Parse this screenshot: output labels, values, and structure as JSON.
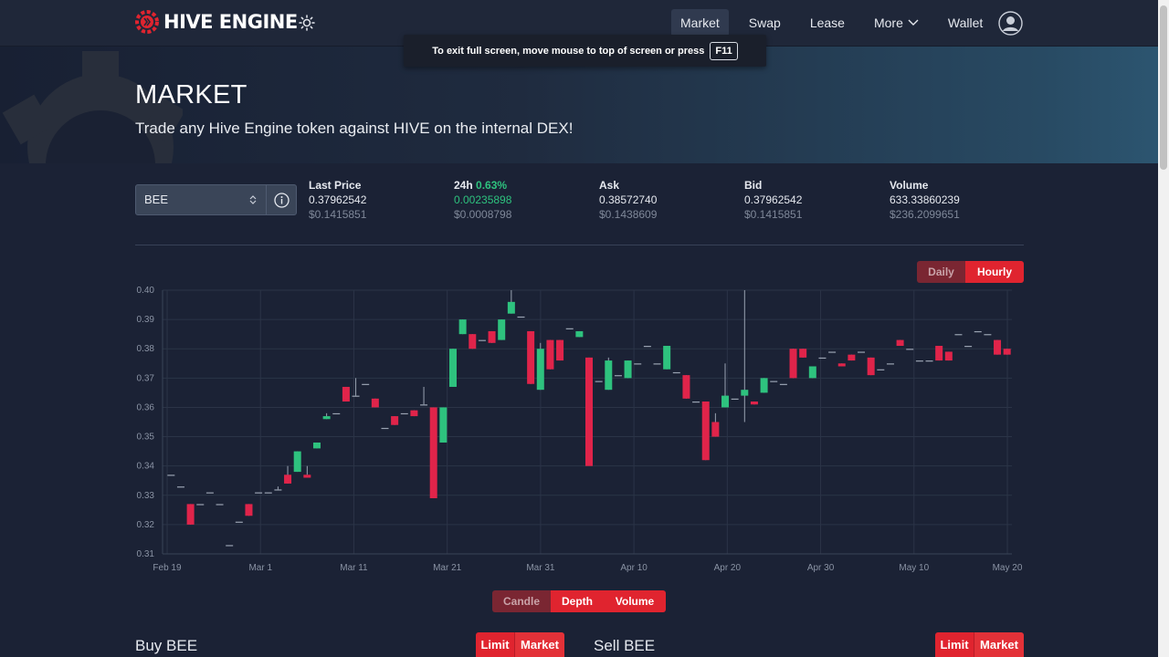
{
  "nav": {
    "brand": "HIVE ENGINE",
    "items": [
      {
        "label": "Market",
        "active": true
      },
      {
        "label": "Swap"
      },
      {
        "label": "Lease"
      },
      {
        "label": "More",
        "dropdown": true
      },
      {
        "label": "Wallet"
      }
    ]
  },
  "toast": {
    "text": "To exit full screen, move mouse to top of screen or press",
    "key": "F11"
  },
  "hero": {
    "title": "MARKET",
    "subtitle": "Trade any Hive Engine token against HIVE on the internal DEX!"
  },
  "token": {
    "selected": "BEE"
  },
  "stats": {
    "last": {
      "label": "Last Price",
      "value": "0.37962542",
      "usd": "$0.1415851"
    },
    "change": {
      "label": "24h",
      "pct": "0.63%",
      "value": "0.00235898",
      "usd": "$0.0008798"
    },
    "ask": {
      "label": "Ask",
      "value": "0.38572740",
      "usd": "$0.1438609"
    },
    "bid": {
      "label": "Bid",
      "value": "0.37962542",
      "usd": "$0.1415851"
    },
    "volume": {
      "label": "Volume",
      "value": "633.33860239",
      "usd": "$236.2099651"
    }
  },
  "interval": {
    "daily": "Daily",
    "hourly": "Hourly",
    "active": "Hourly"
  },
  "chart_mode": {
    "candle": "Candle",
    "depth": "Depth",
    "volume": "Volume"
  },
  "buy": {
    "title": "Buy BEE",
    "limit": "Limit",
    "market": "Market"
  },
  "sell": {
    "title": "Sell BEE",
    "limit": "Limit",
    "market": "Market"
  },
  "colors": {
    "up": "#2ec27e",
    "down": "#e0244a",
    "accent": "#e0242f"
  },
  "chart_data": {
    "type": "candlestick",
    "yticks": [
      "0.40",
      "0.39",
      "0.38",
      "0.37",
      "0.36",
      "0.35",
      "0.34",
      "0.33",
      "0.32",
      "0.31"
    ],
    "xticks": [
      "Feb 19",
      "Mar 1",
      "Mar 11",
      "Mar 21",
      "Mar 31",
      "Apr 10",
      "Apr 20",
      "Apr 30",
      "May 10",
      "May 20"
    ],
    "ylim": [
      0.31,
      0.4
    ],
    "candles": [
      [
        0.337,
        0.337,
        0.337,
        0.337
      ],
      [
        0.333,
        0.333,
        0.333,
        0.333
      ],
      [
        0.327,
        0.327,
        0.32,
        0.32
      ],
      [
        0.327,
        0.327,
        0.327,
        0.327
      ],
      [
        0.331,
        0.331,
        0.331,
        0.331
      ],
      [
        0.327,
        0.327,
        0.327,
        0.327
      ],
      [
        0.313,
        0.313,
        0.313,
        0.313
      ],
      [
        0.321,
        0.321,
        0.321,
        0.321
      ],
      [
        0.327,
        0.327,
        0.323,
        0.323
      ],
      [
        0.331,
        0.331,
        0.331,
        0.331
      ],
      [
        0.331,
        0.331,
        0.331,
        0.331
      ],
      [
        0.332,
        0.333,
        0.332,
        0.332
      ],
      [
        0.337,
        0.34,
        0.334,
        0.334
      ],
      [
        0.338,
        0.345,
        0.338,
        0.345
      ],
      [
        0.337,
        0.34,
        0.337,
        0.336
      ],
      [
        0.346,
        0.348,
        0.346,
        0.348
      ],
      [
        0.356,
        0.358,
        0.356,
        0.357
      ],
      [
        0.358,
        0.358,
        0.358,
        0.358
      ],
      [
        0.367,
        0.367,
        0.362,
        0.362
      ],
      [
        0.364,
        0.37,
        0.364,
        0.364
      ],
      [
        0.368,
        0.368,
        0.368,
        0.368
      ],
      [
        0.363,
        0.363,
        0.36,
        0.36
      ],
      [
        0.353,
        0.353,
        0.353,
        0.353
      ],
      [
        0.357,
        0.357,
        0.354,
        0.354
      ],
      [
        0.358,
        0.358,
        0.358,
        0.358
      ],
      [
        0.359,
        0.359,
        0.357,
        0.357
      ],
      [
        0.361,
        0.367,
        0.361,
        0.361
      ],
      [
        0.36,
        0.36,
        0.329,
        0.329
      ],
      [
        0.348,
        0.36,
        0.348,
        0.36
      ],
      [
        0.367,
        0.38,
        0.367,
        0.38
      ],
      [
        0.385,
        0.39,
        0.385,
        0.39
      ],
      [
        0.385,
        0.385,
        0.38,
        0.38
      ],
      [
        0.383,
        0.383,
        0.383,
        0.383
      ],
      [
        0.386,
        0.386,
        0.382,
        0.382
      ],
      [
        0.383,
        0.39,
        0.383,
        0.39
      ],
      [
        0.392,
        0.4,
        0.392,
        0.396
      ],
      [
        0.391,
        0.391,
        0.391,
        0.391
      ],
      [
        0.386,
        0.386,
        0.368,
        0.368
      ],
      [
        0.366,
        0.382,
        0.366,
        0.38
      ],
      [
        0.383,
        0.383,
        0.373,
        0.373
      ],
      [
        0.383,
        0.383,
        0.376,
        0.376
      ],
      [
        0.387,
        0.387,
        0.387,
        0.387
      ],
      [
        0.384,
        0.386,
        0.384,
        0.386
      ],
      [
        0.377,
        0.377,
        0.35,
        0.34
      ],
      [
        0.369,
        0.369,
        0.369,
        0.369
      ],
      [
        0.366,
        0.377,
        0.366,
        0.376
      ],
      [
        0.371,
        0.371,
        0.371,
        0.371
      ],
      [
        0.37,
        0.376,
        0.37,
        0.376
      ],
      [
        0.375,
        0.375,
        0.375,
        0.375
      ],
      [
        0.381,
        0.381,
        0.381,
        0.381
      ],
      [
        0.375,
        0.375,
        0.375,
        0.375
      ],
      [
        0.373,
        0.381,
        0.373,
        0.381
      ],
      [
        0.372,
        0.372,
        0.372,
        0.372
      ],
      [
        0.371,
        0.371,
        0.363,
        0.363
      ],
      [
        0.362,
        0.362,
        0.362,
        0.362
      ],
      [
        0.362,
        0.362,
        0.342,
        0.342
      ],
      [
        0.355,
        0.358,
        0.35,
        0.35
      ],
      [
        0.36,
        0.375,
        0.36,
        0.364
      ],
      [
        0.363,
        0.363,
        0.363,
        0.363
      ],
      [
        0.364,
        0.4,
        0.355,
        0.366
      ],
      [
        0.362,
        0.362,
        0.361,
        0.361
      ],
      [
        0.365,
        0.37,
        0.365,
        0.37
      ],
      [
        0.369,
        0.369,
        0.369,
        0.369
      ],
      [
        0.368,
        0.368,
        0.368,
        0.368
      ],
      [
        0.38,
        0.38,
        0.37,
        0.37
      ],
      [
        0.38,
        0.38,
        0.377,
        0.377
      ],
      [
        0.37,
        0.374,
        0.37,
        0.374
      ],
      [
        0.377,
        0.377,
        0.377,
        0.377
      ],
      [
        0.379,
        0.379,
        0.379,
        0.379
      ],
      [
        0.375,
        0.375,
        0.374,
        0.374
      ],
      [
        0.378,
        0.378,
        0.376,
        0.376
      ],
      [
        0.379,
        0.379,
        0.379,
        0.379
      ],
      [
        0.377,
        0.377,
        0.371,
        0.371
      ],
      [
        0.373,
        0.373,
        0.373,
        0.373
      ],
      [
        0.375,
        0.375,
        0.375,
        0.375
      ],
      [
        0.383,
        0.383,
        0.381,
        0.381
      ],
      [
        0.38,
        0.38,
        0.38,
        0.38
      ],
      [
        0.376,
        0.376,
        0.376,
        0.376
      ],
      [
        0.376,
        0.376,
        0.376,
        0.376
      ],
      [
        0.381,
        0.381,
        0.376,
        0.376
      ],
      [
        0.379,
        0.379,
        0.376,
        0.376
      ],
      [
        0.385,
        0.385,
        0.385,
        0.385
      ],
      [
        0.381,
        0.381,
        0.381,
        0.381
      ],
      [
        0.386,
        0.386,
        0.386,
        0.386
      ],
      [
        0.385,
        0.385,
        0.385,
        0.385
      ],
      [
        0.383,
        0.383,
        0.378,
        0.378
      ],
      [
        0.38,
        0.38,
        0.378,
        0.378
      ]
    ],
    "directions": "mixed"
  }
}
